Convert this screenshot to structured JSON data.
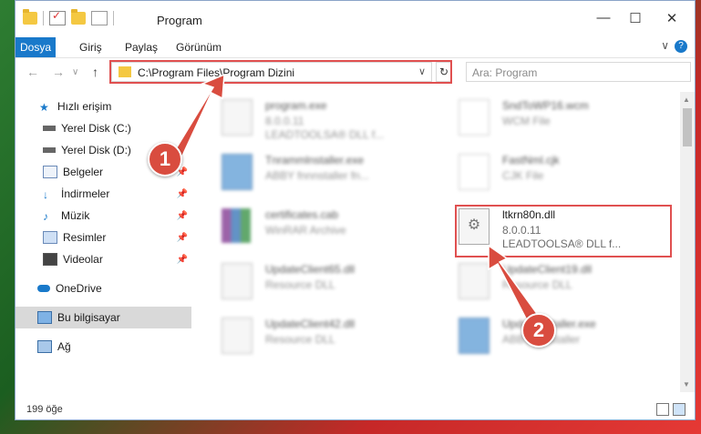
{
  "window": {
    "title": "Program",
    "controls": {
      "minimize": "—",
      "maximize": "☐",
      "close": "✕"
    }
  },
  "ribbon": {
    "tabs": [
      "Dosya",
      "Giriş",
      "Paylaş",
      "Görünüm"
    ],
    "help": "?"
  },
  "nav": {
    "back": "←",
    "forward": "→",
    "up": "↑",
    "recent": "∨",
    "address": "C:\\Program Files\\Program Dizini",
    "address_caret": "∨",
    "refresh": "↻",
    "search_placeholder": "Ara: Program"
  },
  "sidebar": {
    "items": [
      {
        "label": "Hızlı erişim",
        "icon": "star-icon"
      },
      {
        "label": "Yerel Disk (C:)",
        "icon": "drive-icon"
      },
      {
        "label": "Yerel Disk (D:)",
        "icon": "drive-icon"
      },
      {
        "label": "Belgeler",
        "icon": "documents-icon"
      },
      {
        "label": "İndirmeler",
        "icon": "download-icon"
      },
      {
        "label": "Müzik",
        "icon": "music-icon"
      },
      {
        "label": "Resimler",
        "icon": "pictures-icon"
      },
      {
        "label": "Videolar",
        "icon": "video-icon"
      },
      {
        "label": "OneDrive",
        "icon": "cloud-icon"
      },
      {
        "label": "Bu bilgisayar",
        "icon": "computer-icon"
      },
      {
        "label": "Ağ",
        "icon": "network-icon"
      }
    ],
    "pin_glyph": "📌"
  },
  "files": [
    {
      "name": "program.exe",
      "line1": "8.0.0.11",
      "line2": "LEADTOOLSA® DLL f..."
    },
    {
      "name": "Tnrammlnstaller.exe",
      "line1": "ABBY fnnnstaller fn...",
      "line2": ""
    },
    {
      "name": "certificates.cab",
      "line1": "WinRAR Archive",
      "line2": ""
    },
    {
      "name": "UpdateClient65.dll",
      "line1": "Resource DLL",
      "line2": ""
    },
    {
      "name": "UpdateClient42.dll",
      "line1": "Resource DLL",
      "line2": ""
    },
    {
      "name": "SndToWP16.wcm",
      "line1": "WCM File",
      "line2": ""
    },
    {
      "name": "FastNml.cjk",
      "line1": "CJK File",
      "line2": ""
    },
    {
      "name": "ltkrn80n.dll",
      "line1": "8.0.0.11",
      "line2": "LEADTOOLSA® DLL f..."
    },
    {
      "name": "UpdateClient19.dll",
      "line1": "Resource DLL",
      "line2": ""
    },
    {
      "name": "UpdateInstaller.exe",
      "line1": "ABBYY Installer",
      "line2": ""
    }
  ],
  "status": {
    "count": "199 öğe"
  },
  "badges": {
    "one": "1",
    "two": "2"
  },
  "colors": {
    "accent": "#1979ca",
    "highlight": "#e05050",
    "badge": "#d94c3f"
  }
}
